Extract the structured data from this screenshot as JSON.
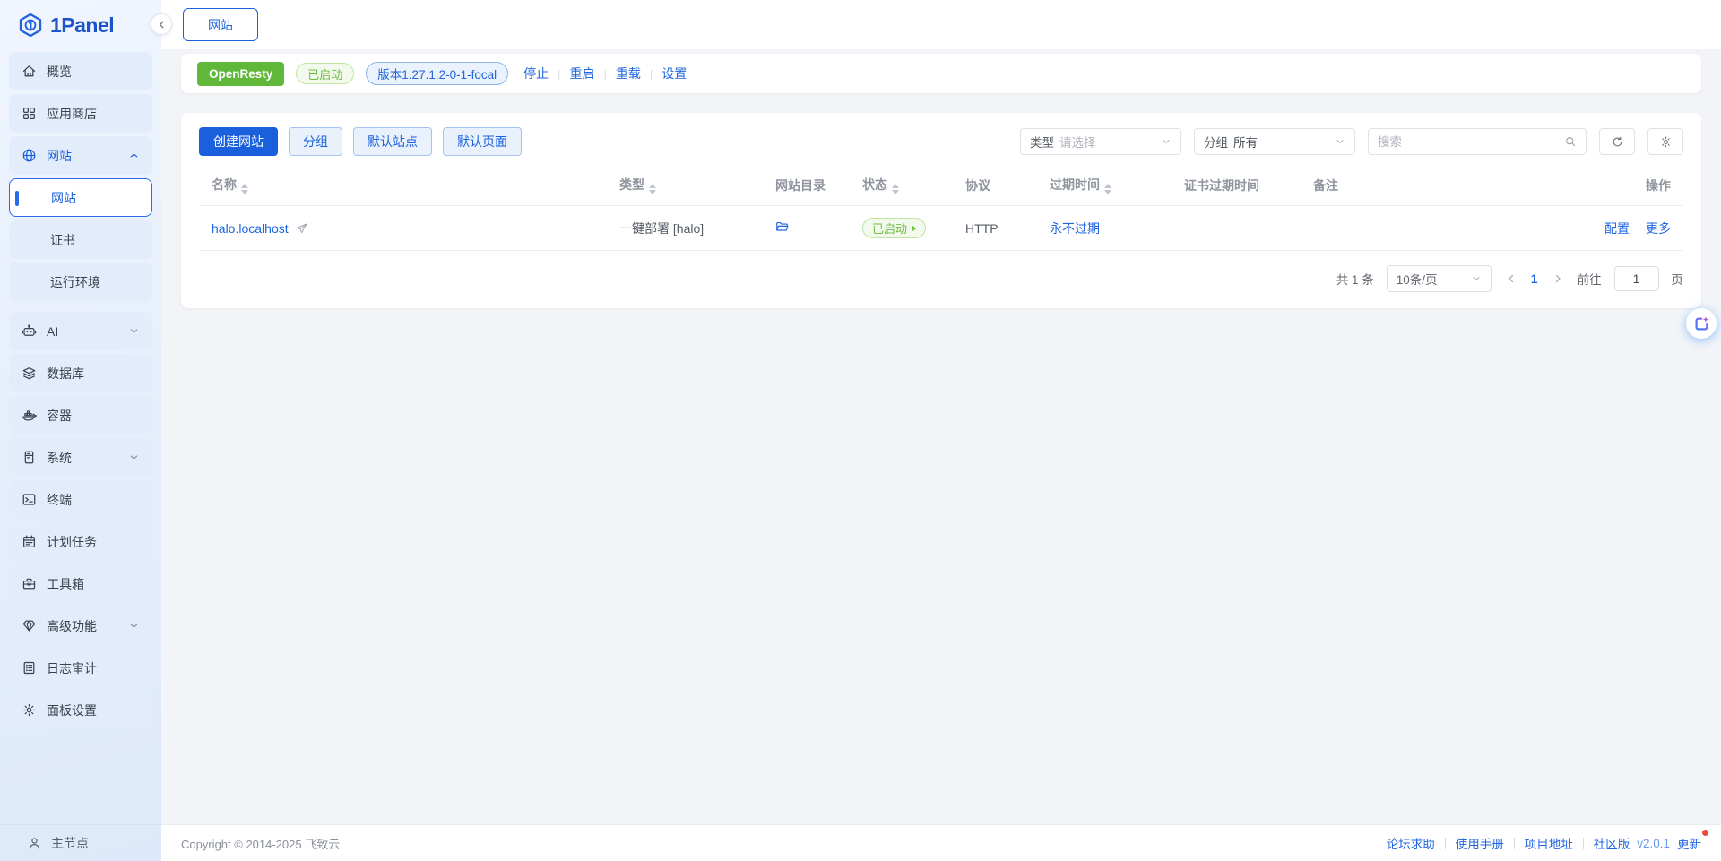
{
  "app": {
    "name": "1Panel"
  },
  "sidebar": {
    "overview": "概览",
    "app_store": "应用商店",
    "website": "网站",
    "sub_website": "网站",
    "sub_cert": "证书",
    "sub_runtime": "运行环境",
    "ai": "AI",
    "database": "数据库",
    "container": "容器",
    "system": "系统",
    "terminal": "终端",
    "cron": "计划任务",
    "toolbox": "工具箱",
    "advanced": "高级功能",
    "logs": "日志审计",
    "settings": "面板设置",
    "node": "主节点"
  },
  "header": {
    "tab": "网站"
  },
  "status": {
    "app_name": "OpenResty",
    "state": "已启动",
    "version": "版本1.27.1.2-0-1-focal",
    "stop": "停止",
    "restart": "重启",
    "reload": "重载",
    "settings": "设置"
  },
  "toolbar": {
    "create": "创建网站",
    "group": "分组",
    "default_site": "默认站点",
    "default_page": "默认页面",
    "type_label": "类型",
    "type_placeholder": "请选择",
    "group_label": "分组",
    "group_value": "所有",
    "search_placeholder": "搜索"
  },
  "table": {
    "headers": [
      "名称",
      "类型",
      "网站目录",
      "状态",
      "协议",
      "过期时间",
      "证书过期时间",
      "备注",
      "操作"
    ],
    "row": {
      "name": "halo.localhost",
      "type": "一键部署 [halo]",
      "state": "已启动",
      "protocol": "HTTP",
      "expire": "永不过期",
      "config": "配置",
      "more": "更多"
    }
  },
  "pagination": {
    "total": "共 1 条",
    "per_page": "10条/页",
    "page": "1",
    "goto": "前往",
    "goto_value": "1",
    "unit": "页"
  },
  "footer": {
    "copyright": "Copyright © 2014-2025 飞致云",
    "forum": "论坛求助",
    "manual": "使用手册",
    "project": "项目地址",
    "edition": "社区版",
    "version": "v2.0.1",
    "update": "更新"
  },
  "colors": {
    "primary": "#1a60dd",
    "success": "#60b83a"
  }
}
